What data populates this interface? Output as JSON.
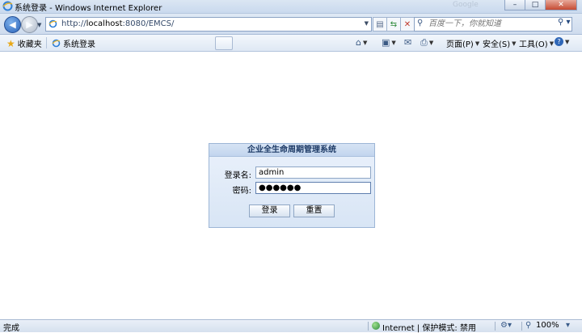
{
  "window": {
    "title": "系统登录 - Windows Internet Explorer",
    "ghost_search_text": "Google",
    "buttons": {
      "minimize": "–",
      "maximize": "□",
      "close": "✕"
    }
  },
  "addressbar": {
    "url_prefix": "http://",
    "url_host": "localhost",
    "url_rest": ":8080/EMCS/",
    "search_placeholder": "百度一下，你就知道"
  },
  "commandbar": {
    "favorites_label": "收藏夹",
    "tab_title": "系统登录",
    "page_menu": "页面(P)",
    "safety_menu": "安全(S)",
    "tools_menu": "工具(O)"
  },
  "login": {
    "title": "企业全生命周期管理系统",
    "username_label": "登录名:",
    "username_value": "admin",
    "password_label": "密码:",
    "password_value": "●●●●●●",
    "login_button": "登录",
    "reset_button": "重置"
  },
  "statusbar": {
    "status_text": "完成",
    "zone_text": "Internet | 保护模式: 禁用",
    "zoom_text": "100%"
  }
}
